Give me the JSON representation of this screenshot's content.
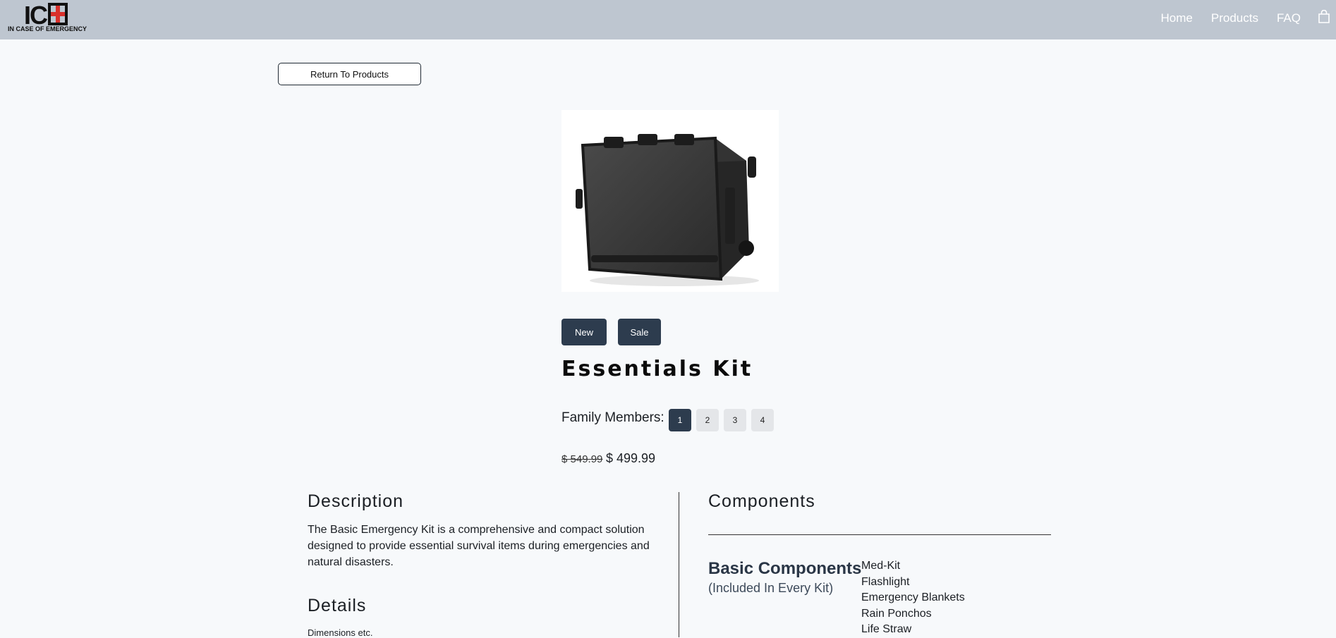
{
  "header": {
    "logo_mark": "IC E",
    "logo_subtitle": "IN CASE OF EMERGENCY",
    "nav": [
      "Home",
      "Products",
      "FAQ"
    ],
    "cart_icon": "shopping-bag-icon"
  },
  "return_button": "Return To Products",
  "product": {
    "image_icon": "hard-case-suitcase-image",
    "badges": [
      "New",
      "Sale"
    ],
    "title": "Essentials Kit",
    "family_label": "Family Members:",
    "family_options": [
      "1",
      "2",
      "3",
      "4"
    ],
    "family_selected": "1",
    "old_price": "$ 549.99",
    "price": "$ 499.99"
  },
  "description": {
    "heading": "Description",
    "text": "The Basic Emergency Kit is a comprehensive and compact solution designed to provide essential survival items during emergencies and natural disasters."
  },
  "details": {
    "heading": "Details",
    "text": "Dimensions etc."
  },
  "components": {
    "heading": "Components",
    "basic_title": "Basic Components",
    "basic_subtitle": "(Included In Every Kit)",
    "items": [
      "Med-Kit",
      "Flashlight",
      "Emergency Blankets",
      "Rain Ponchos",
      "Life Straw"
    ]
  },
  "colors": {
    "topbar": "#bec6d0",
    "accent": "#2d3c4e",
    "background": "#f7f9fb"
  }
}
